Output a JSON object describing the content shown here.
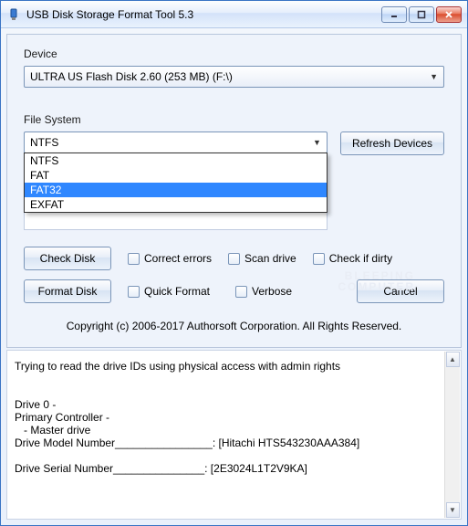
{
  "window": {
    "title": "USB Disk Storage Format Tool 5.3"
  },
  "labels": {
    "device": "Device",
    "filesystem": "File System"
  },
  "device": {
    "selected": "ULTRA US  Flash Disk  2.60 (253 MB) (F:\\)"
  },
  "filesystem": {
    "selected": "NTFS",
    "options": [
      "NTFS",
      "FAT",
      "FAT32",
      "EXFAT"
    ],
    "highlighted_index": 2
  },
  "buttons": {
    "refresh": "Refresh Devices",
    "check": "Check Disk",
    "format": "Format Disk",
    "cancel": "Cancel"
  },
  "checks": {
    "correct": "Correct errors",
    "scan": "Scan drive",
    "dirty": "Check if dirty",
    "quick": "Quick Format",
    "verbose": "Verbose"
  },
  "copyright": "Copyright (c) 2006-2017 Authorsoft Corporation. All Rights Reserved.",
  "log": {
    "l1": "Trying to read the drive IDs using physical access with admin rights",
    "l2": "Drive 0 -",
    "l3": "Primary Controller -",
    "l4": "   - Master drive",
    "l5": "Drive Model Number________________: [Hitachi HTS543230AAA384]",
    "l6": "Drive Serial Number_______________: [2E3024L1T2V9KA]"
  },
  "watermark": {
    "l1": "BLEEPING",
    "l2": "COMPUTER"
  }
}
